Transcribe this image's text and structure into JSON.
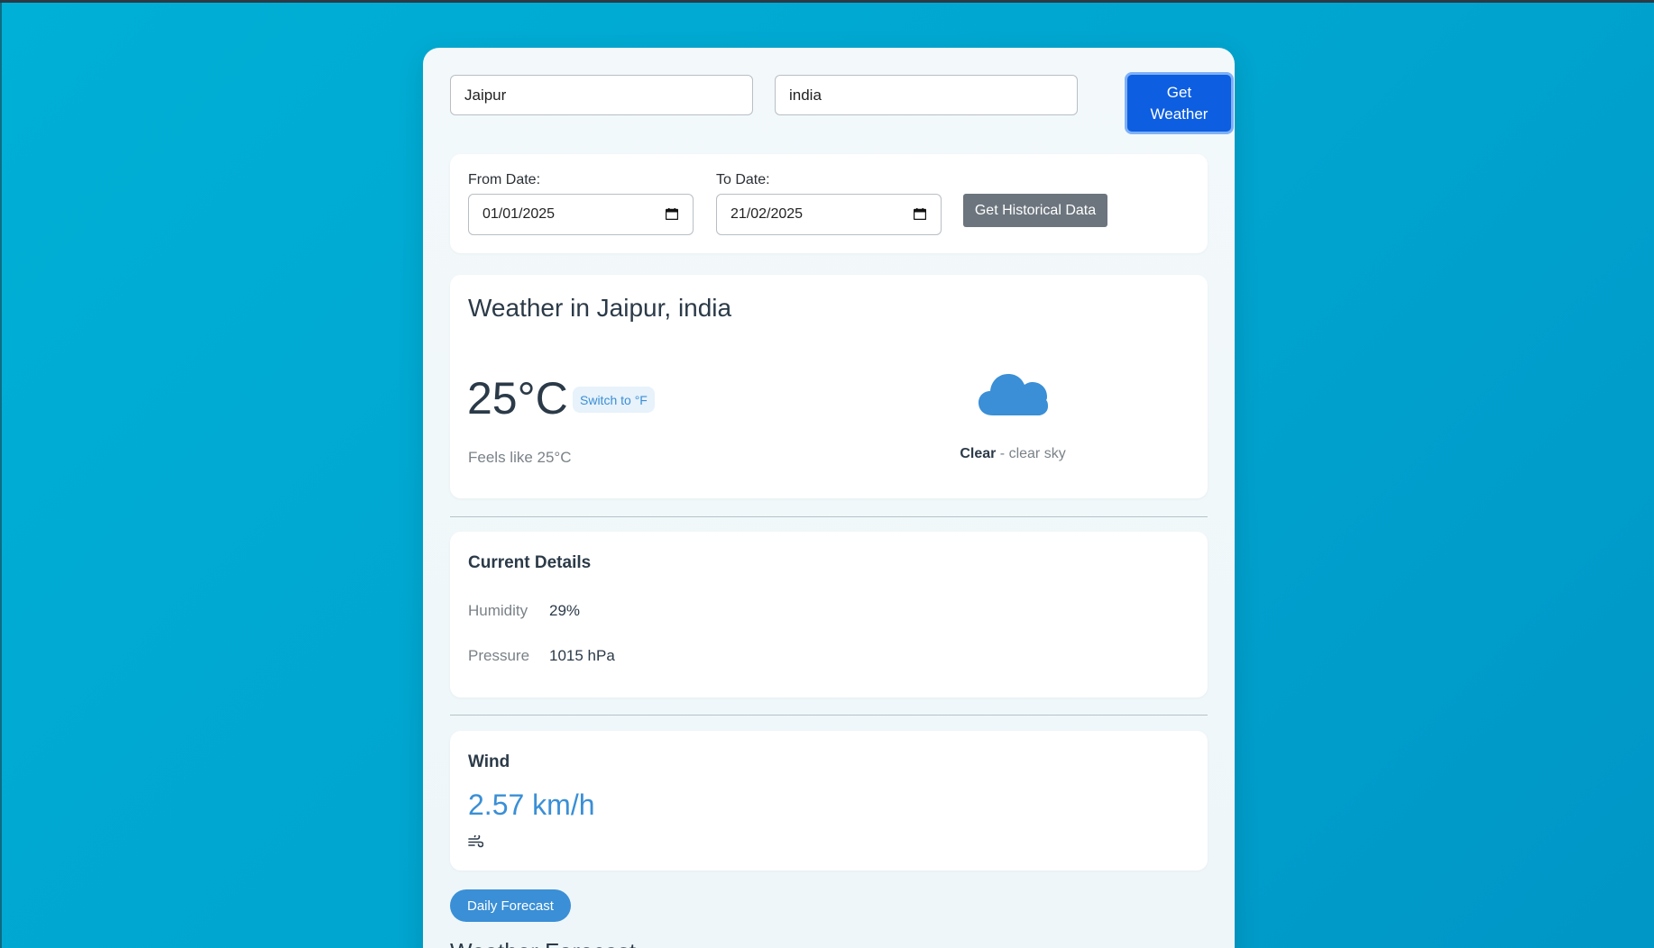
{
  "search": {
    "city_value": "Jaipur",
    "country_value": "india",
    "get_weather_label": "Get Weather"
  },
  "history": {
    "from_label": "From Date:",
    "from_value": "01/01/2025",
    "to_label": "To Date:",
    "to_value": "21/02/2025",
    "button_label": "Get Historical Data"
  },
  "current": {
    "title": "Weather in Jaipur, india",
    "temperature": "25°C",
    "unit_toggle_label": "Switch to °F",
    "feels_like": "Feels like 25°C",
    "condition_main": "Clear",
    "condition_separator": " - ",
    "condition_desc": "clear sky",
    "icon": "cloud-icon"
  },
  "details": {
    "title": "Current Details",
    "humidity_label": "Humidity",
    "humidity_value": "29%",
    "pressure_label": "Pressure",
    "pressure_value": "1015 hPa"
  },
  "wind": {
    "title": "Wind",
    "speed": "2.57 km/h",
    "icon_glyph": "༄",
    "icon": "wind-icon"
  },
  "forecast": {
    "daily_button_label": "Daily Forecast",
    "heading": "Weather Forecast"
  },
  "colors": {
    "background": "#00a4cf",
    "primary_button": "#0d5ee0",
    "accent": "#3a8fd6",
    "secondary_button": "#6c757d"
  }
}
